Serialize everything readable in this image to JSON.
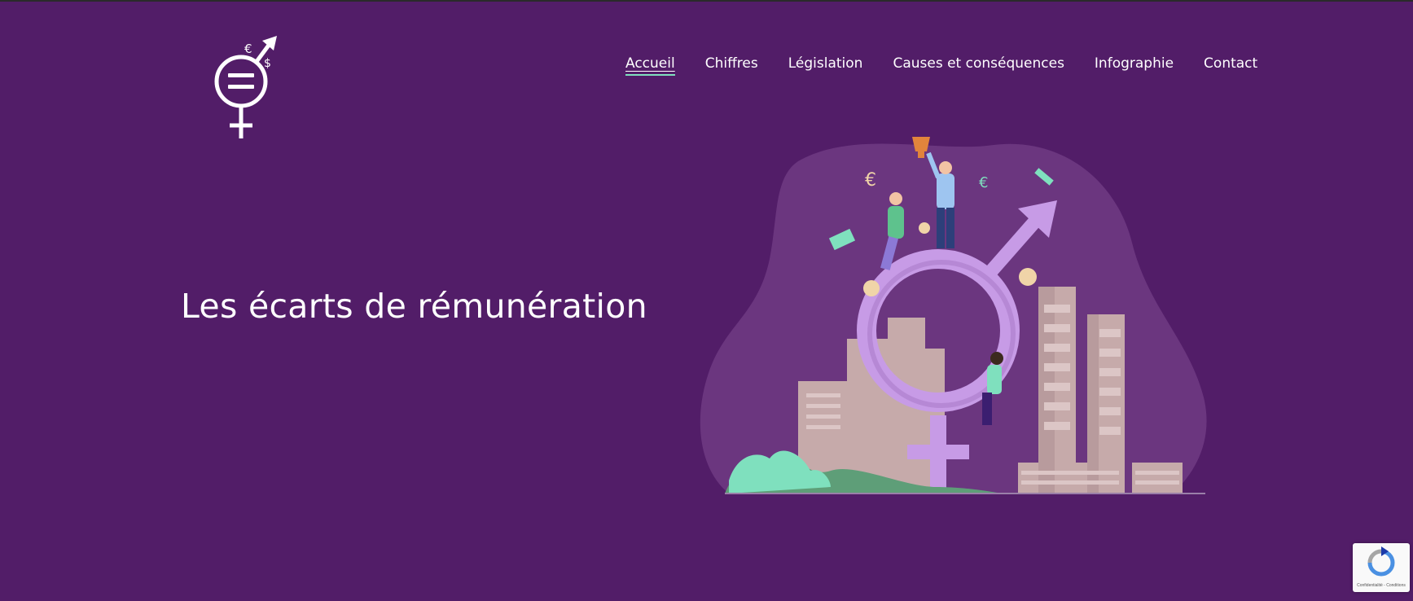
{
  "nav": {
    "items": [
      {
        "label": "Accueil",
        "active": true
      },
      {
        "label": "Chiffres",
        "active": false
      },
      {
        "label": "Législation",
        "active": false
      },
      {
        "label": "Causes et conséquences",
        "active": false
      },
      {
        "label": "Infographie",
        "active": false
      },
      {
        "label": "Contact",
        "active": false
      }
    ]
  },
  "hero": {
    "title": "Les écarts de rémunération"
  },
  "logo": {
    "icon": "gender-equality-logo-icon"
  },
  "illustration": {
    "icon": "gender-pay-gap-illustration"
  },
  "recaptcha": {
    "text": "Confidentialité - Conditions"
  },
  "colors": {
    "background": "#521d68",
    "blob": "#6b367f",
    "accent_green": "#7fe0be",
    "symbol_lilac": "#c79be6",
    "buildings": "#c6aaaa"
  }
}
